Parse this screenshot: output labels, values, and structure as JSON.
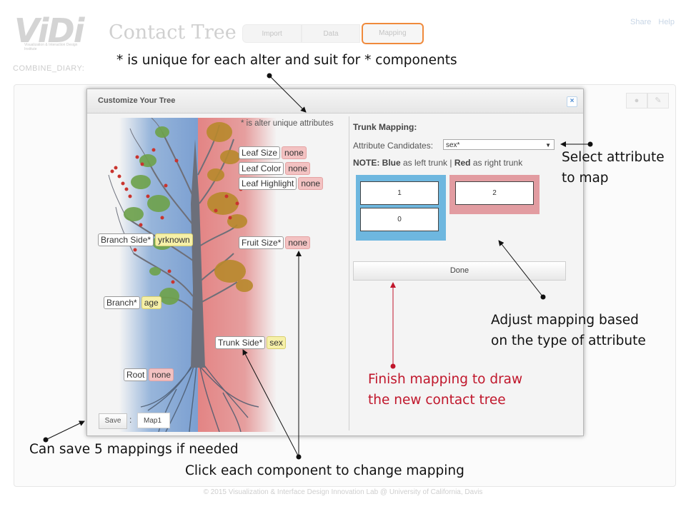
{
  "app": {
    "logo_text": "ViDi",
    "logo_subtext": "Visualization & Interaction Design Institute",
    "title": "Contact Tree",
    "tabs": [
      "Import",
      "Data",
      "Mapping"
    ],
    "active_tab": "Mapping",
    "links": [
      "Share",
      "Help"
    ],
    "dataset": "COMBINE_DIARY:",
    "footer": "© 2015 Visualization & Interface Design Innovation Lab @ University of California, Davis"
  },
  "modal": {
    "title": "Customize Your Tree",
    "close_glyph": "×",
    "alter_note": "* is alter unique attributes",
    "components": {
      "leaf_size": {
        "label": "Leaf Size",
        "value": "none"
      },
      "leaf_color": {
        "label": "Leaf Color",
        "value": "none"
      },
      "leaf_highlight": {
        "label": "Leaf Highlight",
        "value": "none"
      },
      "fruit_size": {
        "label": "Fruit Size*",
        "value": "none"
      },
      "branch_side": {
        "label": "Branch Side*",
        "value": "yrknown"
      },
      "branch": {
        "label": "Branch*",
        "value": "age"
      },
      "trunk_side": {
        "label": "Trunk Side*",
        "value": "sex"
      },
      "root": {
        "label": "Root",
        "value": "none"
      }
    },
    "trunk_mapping": {
      "title": "Trunk Mapping:",
      "attr_label": "Attribute Candidates:",
      "selected": "sex*",
      "note_blue": "NOTE: Blue",
      "note_mid": " as left trunk | ",
      "note_red": "Red",
      "note_end": " as right trunk",
      "left_values": [
        "1",
        "0"
      ],
      "right_values": [
        "2"
      ],
      "done_label": "Done"
    },
    "save_label": "Save",
    "colon": ":",
    "map_name": "Map1"
  },
  "annotations": {
    "unique": "* is unique for each alter and suit for * components",
    "select_1": "Select attribute",
    "select_2": "to map",
    "adjust_1": "Adjust mapping based",
    "adjust_2": "on the type of attribute",
    "finish_1": "Finish mapping to draw",
    "finish_2": "the new contact tree",
    "save": "Can save 5 mappings if needed",
    "click": "Click each component to change mapping"
  },
  "colors": {
    "accent_tab": "#f08a3c",
    "left_trunk": "#6eb7df",
    "right_trunk": "#e29ca1",
    "finish_text": "#c0162b"
  }
}
